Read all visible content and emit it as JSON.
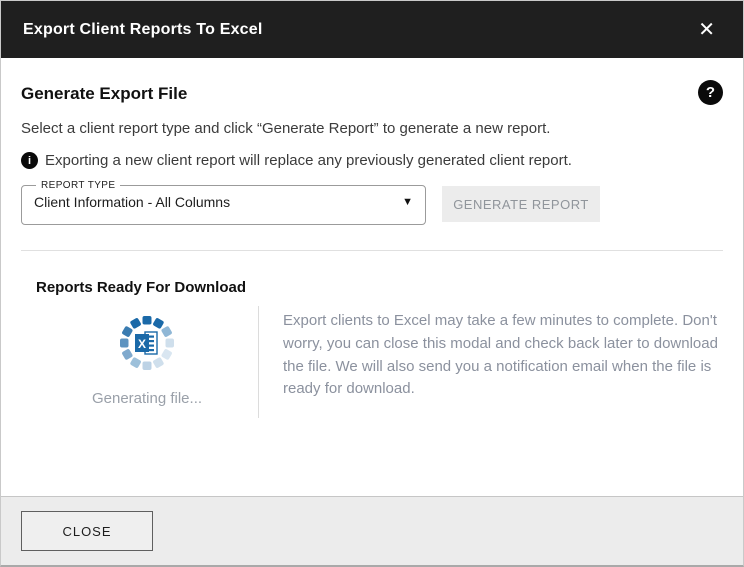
{
  "colors": {
    "header_bg": "#1f1f1f",
    "accent_blue": "#1a69a8",
    "muted_text": "#8b919e",
    "footer_bg": "#ececec"
  },
  "header": {
    "title": "Export Client Reports To Excel",
    "close_icon": "✕"
  },
  "generate_section": {
    "title": "Generate Export File",
    "help_icon": "?",
    "description": "Select a client report type and click “Generate Report” to generate a new report.",
    "info_icon": "i",
    "info_note": "Exporting a new client report will replace any previously generated client report.",
    "report_type": {
      "label": "REPORT TYPE",
      "selected_value": "Client Information - All Columns",
      "arrow_icon": "▼"
    },
    "generate_button_label": "GENERATE REPORT"
  },
  "download_section": {
    "title": "Reports Ready For Download",
    "status_text": "Generating file...",
    "notice_text": "Export clients to Excel may take a few minutes to complete. Don't worry, you can close this modal and check back later to download the file. We will also send you a notification email when the file is ready for download."
  },
  "footer": {
    "close_button_label": "CLOSE"
  }
}
